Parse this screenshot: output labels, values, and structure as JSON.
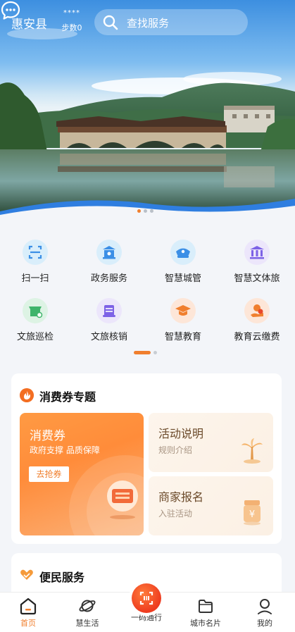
{
  "header": {
    "city": "惠安县",
    "weather_stars": "****",
    "steps": "步数0",
    "search_placeholder": "查找服务"
  },
  "banner": {
    "dots": 3,
    "active_dot": 1
  },
  "grid": {
    "items": [
      {
        "label": "扫一扫",
        "icon": "scan-icon",
        "color": "#d9eefb",
        "accent": "#3b8fe6"
      },
      {
        "label": "政务服务",
        "icon": "government-icon",
        "color": "#d9eefb",
        "accent": "#3b8fe6"
      },
      {
        "label": "智慧城管",
        "icon": "police-cap-icon",
        "color": "#d9eefb",
        "accent": "#3b8fe6"
      },
      {
        "label": "智慧文体旅",
        "icon": "museum-icon",
        "color": "#ece6fb",
        "accent": "#7d62e6"
      },
      {
        "label": "文旅巡检",
        "icon": "shop-inspect-icon",
        "color": "#ddf3e4",
        "accent": "#3fb46b"
      },
      {
        "label": "文旅核销",
        "icon": "ticket-stack-icon",
        "color": "#ece6fb",
        "accent": "#7d62e6"
      },
      {
        "label": "智慧教育",
        "icon": "graduation-cap-icon",
        "color": "#fde6d8",
        "accent": "#f07f2e"
      },
      {
        "label": "教育云缴费",
        "icon": "payment-hand-icon",
        "color": "#fde6d8",
        "accent": "#f07f2e"
      }
    ]
  },
  "coupon": {
    "section_title": "消费券专题",
    "main_title": "消费券",
    "main_subtitle": "政府支撑 品质保障",
    "grab_label": "去抢券",
    "activity_title": "活动说明",
    "activity_sub": "规则介绍",
    "merchant_title": "商家报名",
    "merchant_sub": "入驻活动"
  },
  "service": {
    "section_title": "便民服务"
  },
  "tabbar": {
    "items": [
      {
        "label": "首页",
        "icon": "home-icon"
      },
      {
        "label": "慧生活",
        "icon": "planet-icon"
      },
      {
        "label": "一码通行",
        "icon": "qrcode-scan-icon"
      },
      {
        "label": "城市名片",
        "icon": "folder-icon"
      },
      {
        "label": "我的",
        "icon": "user-icon"
      }
    ],
    "active": "首页"
  },
  "colors": {
    "accent": "#f07f2e",
    "primary_blue": "#3b8fe6"
  }
}
